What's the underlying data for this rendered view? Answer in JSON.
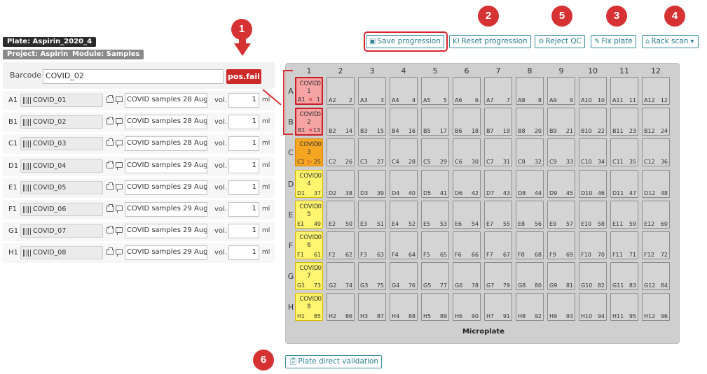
{
  "plate_tag": "Plate: Aspirin_2020_4",
  "project_tag": "Project: Aspirin",
  "module_tag": "Module: Samples",
  "barcode": {
    "label": "Barcode",
    "value": "COVID_02",
    "status": "pos.fail"
  },
  "samples": [
    {
      "pos": "A1",
      "code": "COVID_01",
      "desc": "COVID samples 28 Aug",
      "vol_label": "vol.",
      "vol": "1",
      "unit": "ml"
    },
    {
      "pos": "B1",
      "code": "COVID_02",
      "desc": "COVID samples 28 Aug",
      "vol_label": "vol.",
      "vol": "1",
      "unit": "ml"
    },
    {
      "pos": "C1",
      "code": "COVID_03",
      "desc": "COVID samples 28 Aug",
      "vol_label": "vol.",
      "vol": "1",
      "unit": "ml"
    },
    {
      "pos": "D1",
      "code": "COVID_04",
      "desc": "COVID samples 29 Aug",
      "vol_label": "vol.",
      "vol": "1",
      "unit": "ml"
    },
    {
      "pos": "E1",
      "code": "COVID_05",
      "desc": "COVID samples 29 Aug",
      "vol_label": "vol.",
      "vol": "1",
      "unit": "ml"
    },
    {
      "pos": "F1",
      "code": "COVID_06",
      "desc": "COVID samples 29 Aug",
      "vol_label": "vol.",
      "vol": "1",
      "unit": "ml"
    },
    {
      "pos": "G1",
      "code": "COVID_07",
      "desc": "COVID samples 29 Aug",
      "vol_label": "vol.",
      "vol": "1",
      "unit": "ml"
    },
    {
      "pos": "H1",
      "code": "COVID_08",
      "desc": "COVID samples 29 Aug",
      "vol_label": "vol.",
      "vol": "1",
      "unit": "ml"
    }
  ],
  "toolbar": {
    "save": "Save progression",
    "reset": "Reset progression",
    "reject": "Reject QC",
    "fix": "Fix plate",
    "rack": "Rack scan"
  },
  "callouts": [
    "1",
    "2",
    "5",
    "3",
    "4",
    "6"
  ],
  "plate": {
    "label": "Microplate",
    "columns": [
      "1",
      "2",
      "3",
      "4",
      "5",
      "6",
      "7",
      "8",
      "9",
      "10",
      "11",
      "12"
    ],
    "rows": [
      "A",
      "B",
      "C",
      "D",
      "E",
      "F",
      "G",
      "H"
    ],
    "first_column_wells": [
      {
        "title": "COVID",
        "zero": "0",
        "idx": "1",
        "name": "A1",
        "num": "1",
        "state": "failed",
        "mark": "✕"
      },
      {
        "title": "COVID",
        "zero": "0",
        "idx": "2",
        "name": "B1",
        "num": "13",
        "state": "failed",
        "mark": "✕"
      },
      {
        "title": "COVID",
        "zero": "0",
        "idx": "3",
        "name": "C1",
        "num": "25",
        "state": "orange",
        "mark": "▷"
      },
      {
        "title": "COVID",
        "zero": "0",
        "idx": "4",
        "name": "D1",
        "num": "37",
        "state": "filled",
        "mark": ""
      },
      {
        "title": "COVID",
        "zero": "0",
        "idx": "5",
        "name": "E1",
        "num": "49",
        "state": "filled",
        "mark": ""
      },
      {
        "title": "COVID",
        "zero": "0",
        "idx": "6",
        "name": "F1",
        "num": "61",
        "state": "filled",
        "mark": ""
      },
      {
        "title": "COVID",
        "zero": "0",
        "idx": "7",
        "name": "G1",
        "num": "73",
        "state": "filled",
        "mark": ""
      },
      {
        "title": "COVID",
        "zero": "0",
        "idx": "8",
        "name": "H1",
        "num": "85",
        "state": "filled",
        "mark": ""
      }
    ]
  },
  "direct_validation": "Plate direct validation",
  "colors": {
    "accent": "#2c7d8c",
    "callout": "#d63234",
    "fail": "#f5a3a3",
    "filled": "#fff56e",
    "active": "#f6a623"
  }
}
